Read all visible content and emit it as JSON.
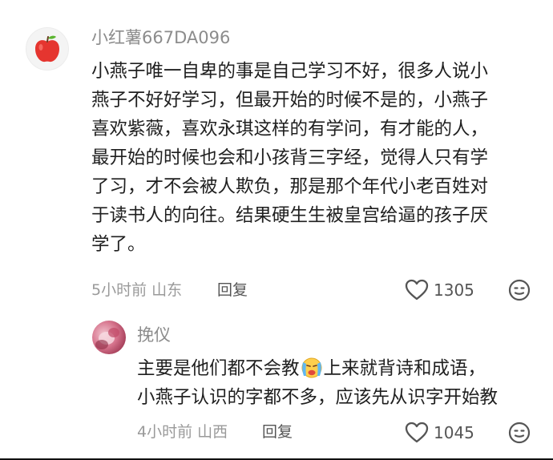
{
  "comment": {
    "username": "小红薯667DA096",
    "avatar_icon": "apple-icon",
    "lines": [
      "小燕子唯一自卑的事是自己学习不好，很多人说小",
      "燕子不好好学习，但最开始的时候不是的，小燕子",
      "喜欢紫薇，喜欢永琪这样的有学问，有才能的人，",
      "最开始的时候也会和小孩背三字经，觉得人只有学",
      "了习，才不会被人欺负，那是那个年代小老百姓对",
      "于读书人的向往。结果硬生生被皇宫给逼的孩子厌",
      "学了。"
    ],
    "time_location": "5小时前 山东",
    "reply_label": "回复",
    "like_count": "1305"
  },
  "reply": {
    "username": "挽仪",
    "line1_before": "主要是他们都不会教",
    "inline_emoji": "crying-face-emoji",
    "line1_after": "上来就背诗和成语，",
    "line2": "小燕子认识的字都不多，应该先从识字开始教",
    "time_location": "4小时前 山西",
    "reply_label": "回复",
    "like_count": "1045"
  },
  "colors": {
    "text": "#1f1f1f",
    "meta": "#9a9a9a",
    "username": "#8c8c8c",
    "icon": "#555555"
  }
}
